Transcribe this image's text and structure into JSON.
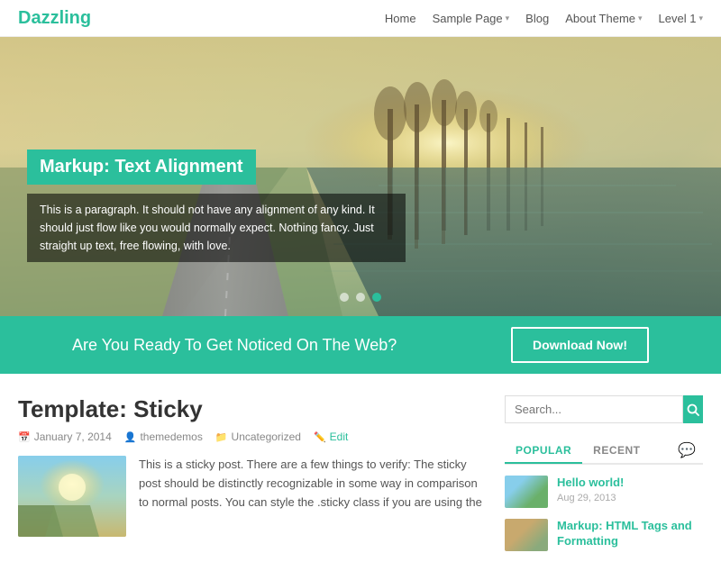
{
  "header": {
    "site_title": "Dazzling",
    "nav": [
      {
        "label": "Home",
        "has_arrow": false
      },
      {
        "label": "Sample Page",
        "has_arrow": true
      },
      {
        "label": "Blog",
        "has_arrow": false
      },
      {
        "label": "About Theme",
        "has_arrow": true
      },
      {
        "label": "Level 1",
        "has_arrow": true
      }
    ]
  },
  "hero": {
    "caption_title": "Markup: Text Alignment",
    "caption_text": "This is a paragraph. It should not have any alignment of any kind. It should just flow like you would normally expect. Nothing fancy. Just straight up text, free flowing, with love.",
    "dots": [
      {
        "active": false
      },
      {
        "active": false
      },
      {
        "active": true
      }
    ]
  },
  "cta": {
    "text": "Are You Ready To Get Noticed On The Web?",
    "button_label": "Download Now!"
  },
  "post": {
    "title": "Template: Sticky",
    "meta": {
      "date": "January 7, 2014",
      "author": "themedemos",
      "category": "Uncategorized",
      "edit": "Edit"
    },
    "excerpt": "This is a sticky post. There are a few things to verify: The sticky post should be distinctly recognizable in some way in comparison to normal posts. You can style the .sticky class if you are using the"
  },
  "sidebar": {
    "search_placeholder": "Search...",
    "tabs": [
      "POPULAR",
      "RECENT"
    ],
    "chat_icon": "💬",
    "recent_items": [
      {
        "title": "Hello world!",
        "date": "Aug 29, 2013"
      },
      {
        "title": "Markup: HTML Tags and Formatting",
        "date": ""
      }
    ]
  },
  "icons": {
    "search": "🔍",
    "calendar": "📅",
    "user": "👤",
    "folder": "📁",
    "edit": "✏️"
  }
}
